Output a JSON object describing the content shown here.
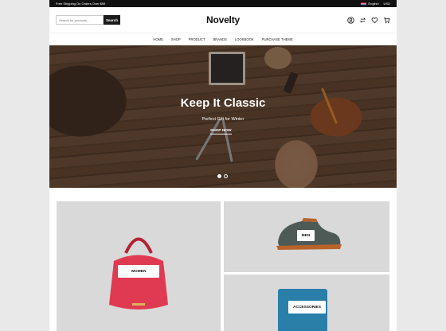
{
  "topbar": {
    "shipping": "Free Shipping On Orders Over $59",
    "language": "English",
    "currency": "USD"
  },
  "header": {
    "logo": "Novelty",
    "search_placeholder": "Search for products...",
    "search_button": "Search",
    "icons": [
      "account-icon",
      "compare-icon",
      "wishlist-icon",
      "cart-icon"
    ]
  },
  "nav": [
    "HOME",
    "SHOP",
    "PRODUCT",
    "BRANDS",
    "LOOKBOOK",
    "PURCHASE THEME"
  ],
  "hero": {
    "title": "Keep It Classic",
    "subtitle": "Perfect Gift for Winter",
    "cta": "SHOP NOW",
    "slides": 2,
    "active_slide": 1
  },
  "categories": {
    "women": "WOMEN",
    "men": "MEN",
    "accessories": "ACCESSORIES"
  },
  "colors": {
    "bag": "#e03a52",
    "wallet": "#2a7fa8",
    "shoe_suede": "#4e5a56",
    "shoe_leather": "#b8632a"
  }
}
